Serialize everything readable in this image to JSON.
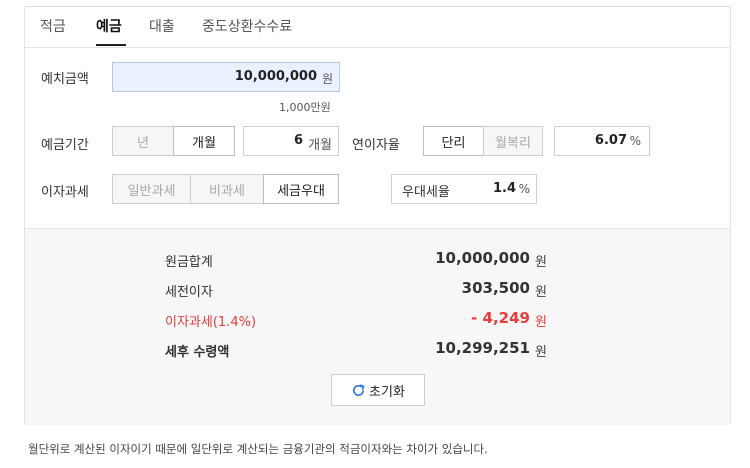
{
  "tabs": [
    {
      "label": "적금",
      "active": false
    },
    {
      "label": "예금",
      "active": true
    },
    {
      "label": "대출",
      "active": false
    },
    {
      "label": "중도상환수수료",
      "active": false
    }
  ],
  "form": {
    "amount": {
      "label": "예치금액",
      "value": "10,000,000",
      "unit": "원",
      "hint": "1,000만원"
    },
    "period": {
      "label": "예금기간",
      "unit_options": [
        "년",
        "개월"
      ],
      "selected_unit": "개월",
      "value": "6",
      "value_unit": "개월"
    },
    "rate": {
      "label": "연이자율",
      "type_options": [
        "단리",
        "월복리"
      ],
      "selected_type": "단리",
      "value": "6.07",
      "unit": "%"
    },
    "tax": {
      "label": "이자과세",
      "options": [
        "일반과세",
        "비과세",
        "세금우대"
      ],
      "selected": "세금우대",
      "preferential_label": "우대세율",
      "preferential_value": "1.4",
      "preferential_unit": "%"
    }
  },
  "result": {
    "rows": [
      {
        "label": "원금합계",
        "value": "10,000,000",
        "unit": "원"
      },
      {
        "label": "세전이자",
        "value": "303,500",
        "unit": "원"
      },
      {
        "label": "이자과세(1.4%)",
        "value": "- 4,249",
        "unit": "원"
      },
      {
        "label": "세후 수령액",
        "value": "10,299,251",
        "unit": "원"
      }
    ],
    "reset_label": "초기화"
  },
  "note": "월단위로 계산된 이자이기 때문에 일단위로 계산되는 금융기관의 적금이자와는 차이가 있습니다.",
  "colors": {
    "accent_bg": "#eaf1fe",
    "accent_border": "#b9c8e6",
    "negative": "#e63c3c",
    "reset_icon": "#2f7bd6"
  }
}
